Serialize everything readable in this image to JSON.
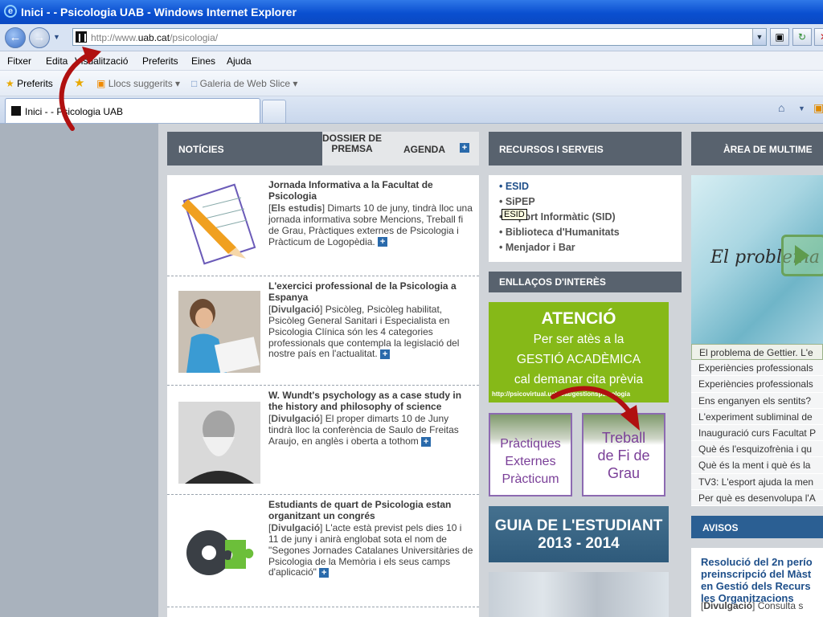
{
  "window": {
    "title": "Inici - - Psicologia UAB - Windows Internet Explorer"
  },
  "address": {
    "url_prefix": "http://www.",
    "url_domain": "uab.cat",
    "url_path": "/psicologia/"
  },
  "menu": [
    "Fitxer",
    "Edita",
    "Visualització",
    "Preferits",
    "Eines",
    "Ajuda"
  ],
  "favbar": {
    "favorites": "Preferits",
    "suggested": "Llocs suggerits ▾",
    "webslice": "Galeria de Web Slice ▾"
  },
  "tab": {
    "label": "Inici - - Psicologia UAB"
  },
  "headers": {
    "noticies": "NOTÍCIES",
    "dossier": "DOSSIER DE PREMSA",
    "agenda": "AGENDA",
    "recursos": "RECURSOS I SERVEIS",
    "multimedia": "ÀREA DE MULTIME",
    "enllacos": "ENLLAÇOS D'INTERÈS",
    "avisos": "AVISOS"
  },
  "news": [
    {
      "title": "Jornada Informativa a la Facultat de Psicologia",
      "category": "Els estudis",
      "text": "Dimarts 10 de juny, tindrà lloc una jornada informativa sobre Mencions, Treball fi de Grau, Pràctiques externes de Psicologia i Pràcticum de Logopèdia."
    },
    {
      "title": "L'exercici professional de la Psicologia a Espanya",
      "category": "Divulgació",
      "text": "Psicòleg, Psicòleg habilitat, Psicòleg General Sanitari i Especialista en Psicologia Clínica són les 4 categories professionals que contempla la legislació del nostre país en l'actualitat."
    },
    {
      "title": "W. Wundt's psychology as a case study in the history and philosophy of science",
      "category": "Divulgació",
      "text": "El proper dimarts 10 de Juny tindrà lloc la conferència de Saulo de Freitas Araujo, en anglès i oberta a tothom"
    },
    {
      "title": "Estudiants de quart de Psicologia estan organitzant un congrés",
      "category": "Divulgació",
      "text": "L'acte està previst pels dies 10 i 11 de juny i anirà englobat sota el nom de \"Segones Jornades Catalanes Universitàries de Psicologia de la Memòria i els seus camps d'aplicació\""
    }
  ],
  "resources": [
    "• ESID",
    "• SiPEP",
    "• Suport Informàtic (SID)",
    "• Biblioteca d'Humanitats",
    "• Menjador i Bar"
  ],
  "tooltip": "ESID",
  "atencio": {
    "title": "ATENCIÓ",
    "line1": "Per ser atès a la",
    "line2": "GESTIÓ ACADÈMICA",
    "line3": "cal demanar cita prèvia",
    "url": "http://psicovirtual.uab.cat/gestionspsicologia"
  },
  "tiles": {
    "practiques": [
      "Pràctiques",
      "Externes",
      "Pràcticum"
    ],
    "treball": [
      "Treball",
      "de Fi de",
      "Grau"
    ]
  },
  "guia": {
    "line1": "GUIA DE L'ESTUDIANT",
    "line2": "2013 - 2014"
  },
  "media": {
    "script": "El problema d"
  },
  "videos": [
    "El problema de Gettier. L'e",
    "Experiències professionals",
    "Experiències professionals",
    "Ens enganyen els sentits?",
    "L'experiment subliminal de",
    "Inauguració curs Facultat P",
    "Què és l'esquizofrènia i qu",
    "Què és la ment i què és la",
    "TV3: L'esport ajuda la men",
    "Per què es desenvolupa l'A"
  ],
  "avisos": {
    "title": "Resolució del 2n perío preinscripció del Màst en Gestió dels Recurs les Organitzacions",
    "category": "Divulgació",
    "text": "Consulta s"
  }
}
